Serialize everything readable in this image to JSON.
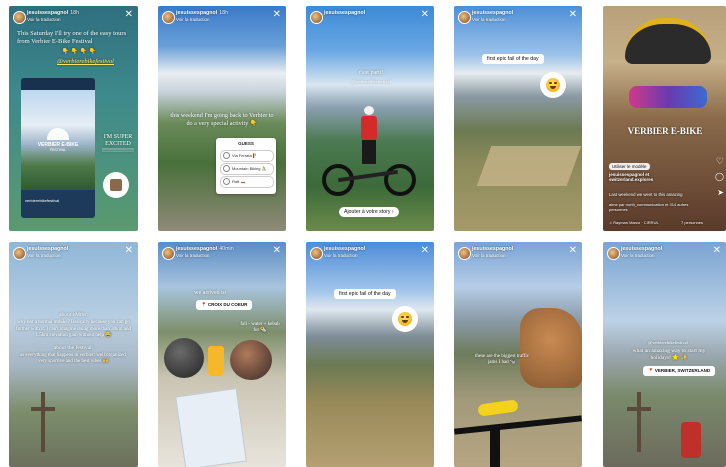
{
  "stories": [
    {
      "user": "jesuissespagnol",
      "time": "18h",
      "translate": "Voir la traduction",
      "caption": "This Saturday I'll try one of the easy tours from Verbier E-Bike Festival",
      "emojis": "👇 👇 👇 👇",
      "mention": "@verbierebikefestival",
      "logo": "VERBIER E-BIKE",
      "logo_sub": "FESTIVAL",
      "card_caption": "verbierebikefestival",
      "side": "I'M SUPER EXCITED !!!!!!!!!!!!!!!!"
    },
    {
      "user": "jesuissespagnol",
      "time": "18h",
      "translate": "Voir la traduction",
      "caption": "this weekend I'm going back to Verbier to do a very special activity 👇",
      "poll_title": "GUESS",
      "poll": [
        "Via Ferrata 🧗",
        "Mountain Biking 🚴",
        "Raft 🛶"
      ]
    },
    {
      "user": "jesuissespagnol",
      "time": "",
      "translate": "",
      "caption": "c'est parti!",
      "mention": "@verbierebikefestival",
      "button": "Ajouter à votre story ›"
    },
    {
      "user": "jesuissespagnol",
      "time": "",
      "translate": "Voir la traduction",
      "caption": "first epic fail of the day"
    },
    {
      "text_big": "VERBIER E-BIKE",
      "use_template": "Utiliser le modèle",
      "explore_user": "jesuissespagnol et",
      "explore_user2": "switzerland.explores",
      "caption": "Last weekend we went to this amazing",
      "loved": "aime par north_communication et 314 autres personnes",
      "audio": "♫ Rayman Marco · CIRRUL",
      "followers": "7 personnes"
    },
    {
      "user": "jesuissespagnol",
      "time": "",
      "translate": "Voir la traduction",
      "p1": "about eMtbs:",
      "p2": "why not a normal mtbike? Basically because you can go further with it. I can't imagine doing more than 30km and 1.5km elevation gain without help 😅",
      "p3": "about the festival:",
      "p4": "as everything that happens in verbier: well organized, very sportive and the best vibes 🙌"
    },
    {
      "user": "jesuissespagnol",
      "time": "40min",
      "translate": "Voir la traduction",
      "caption": "we arrived to",
      "tag": "📍 CROIX DU COEUR",
      "side": "fall - water + kebab for 🌯"
    },
    {
      "user": "jesuissespagnol",
      "time": "",
      "translate": "Voir la traduction",
      "caption": "first epic fail of the day"
    },
    {
      "user": "jesuissespagnol",
      "time": "",
      "translate": "Voir la traduction",
      "caption": "these are the biggest traffic jams I had 🐄"
    },
    {
      "user": "jesuissespagnol",
      "time": "",
      "translate": "Voir la traduction",
      "mention": "@verbierebikefestival",
      "caption": "what an amazing way to start my holidays! 🌟 ✨",
      "tag": "📍 VERBIER, SWITZERLAND"
    }
  ],
  "colors": {
    "teal": "#5aa89a",
    "sky": "#8fb8dc",
    "grass": "#9a9a4a"
  }
}
